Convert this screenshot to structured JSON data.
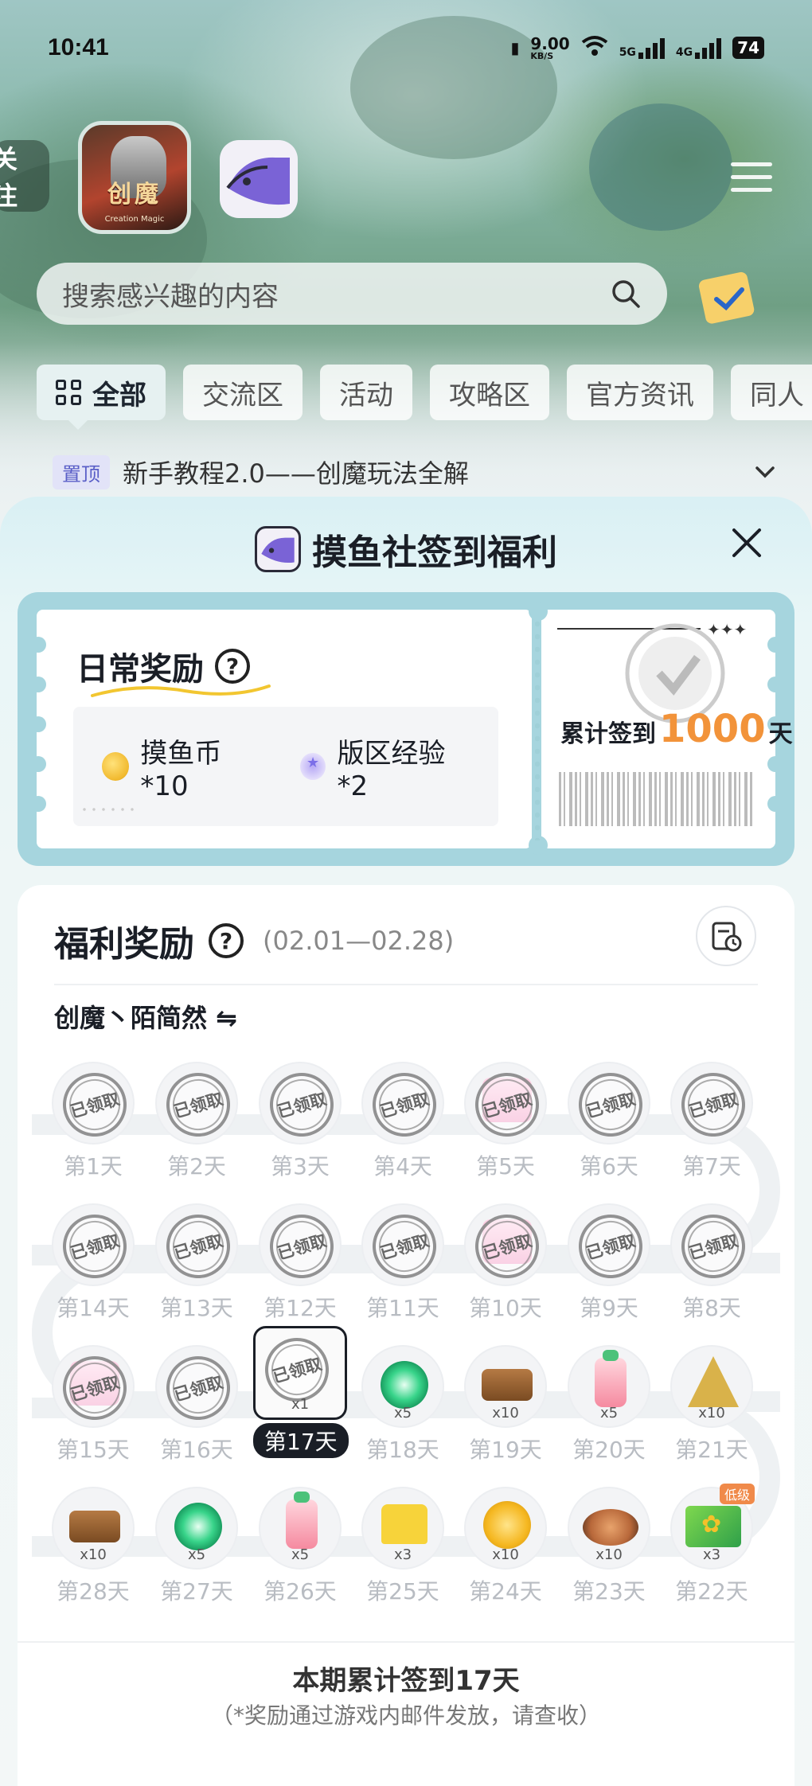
{
  "status_bar": {
    "time": "10:41",
    "speed": "9.00",
    "speed_unit": "KB/S",
    "net1": "5G",
    "net2": "4G",
    "battery": "74"
  },
  "header": {
    "follow_label": "关注",
    "game_logo_text": "创魔",
    "game_logo_sub": "Creation Magic"
  },
  "search": {
    "placeholder": "搜索感兴趣的内容"
  },
  "tabs": [
    "全部",
    "交流区",
    "活动",
    "攻略区",
    "官方资讯",
    "同人"
  ],
  "pinned": {
    "tag": "置顶",
    "text": "新手教程2.0——创魔玩法全解"
  },
  "sheet": {
    "title": "摸鱼社签到福利",
    "daily": {
      "title": "日常奖励",
      "rewards": [
        {
          "icon": "coin-icon",
          "label": "摸鱼币*10"
        },
        {
          "icon": "exp-icon",
          "label": "版区经验*2"
        }
      ],
      "cumulative_prefix": "累计签到",
      "cumulative_days": "1000",
      "cumulative_suffix": "天"
    },
    "welfare": {
      "title": "福利奖励",
      "date_range": "(02.01—02.28)",
      "user": "创魔丶陌简然 ⇋",
      "claimed_text": "已领取",
      "days": [
        {
          "label": "第1天",
          "claimed": true
        },
        {
          "label": "第2天",
          "claimed": true
        },
        {
          "label": "第3天",
          "claimed": true
        },
        {
          "label": "第4天",
          "claimed": true
        },
        {
          "label": "第5天",
          "claimed": true,
          "item": "gift"
        },
        {
          "label": "第6天",
          "claimed": true
        },
        {
          "label": "第7天",
          "claimed": true
        },
        {
          "label": "第14天",
          "claimed": true
        },
        {
          "label": "第13天",
          "claimed": true
        },
        {
          "label": "第12天",
          "claimed": true
        },
        {
          "label": "第11天",
          "claimed": true
        },
        {
          "label": "第10天",
          "claimed": true,
          "item": "gift"
        },
        {
          "label": "第9天",
          "claimed": true
        },
        {
          "label": "第8天",
          "claimed": true
        },
        {
          "label": "第15天",
          "claimed": true,
          "item": "gift"
        },
        {
          "label": "第16天",
          "claimed": true
        },
        {
          "label": "第17天",
          "claimed": true,
          "current": true,
          "qty": "x1"
        },
        {
          "label": "第18天",
          "item": "gem",
          "qty": "x5"
        },
        {
          "label": "第19天",
          "item": "bag",
          "qty": "x10"
        },
        {
          "label": "第20天",
          "item": "bottle",
          "qty": "x5"
        },
        {
          "label": "第21天",
          "item": "crystal",
          "qty": "x10"
        },
        {
          "label": "第28天",
          "item": "bag",
          "qty": "x10"
        },
        {
          "label": "第27天",
          "item": "gem",
          "qty": "x5"
        },
        {
          "label": "第26天",
          "item": "bottle",
          "qty": "x5"
        },
        {
          "label": "第25天",
          "item": "shirt",
          "qty": "x3"
        },
        {
          "label": "第24天",
          "item": "shell",
          "qty": "x10"
        },
        {
          "label": "第23天",
          "item": "food",
          "qty": "x10"
        },
        {
          "label": "第22天",
          "item": "card",
          "qty": "x3",
          "badge": "低级"
        }
      ],
      "footer_main": "本期累计签到17天",
      "footer_sub": "（*奖励通过游戏内邮件发放，请查收）"
    }
  },
  "colors": {
    "accent_orange": "#f2933a",
    "ticket_frame": "#a6d5de",
    "dark": "#1a1e26"
  }
}
